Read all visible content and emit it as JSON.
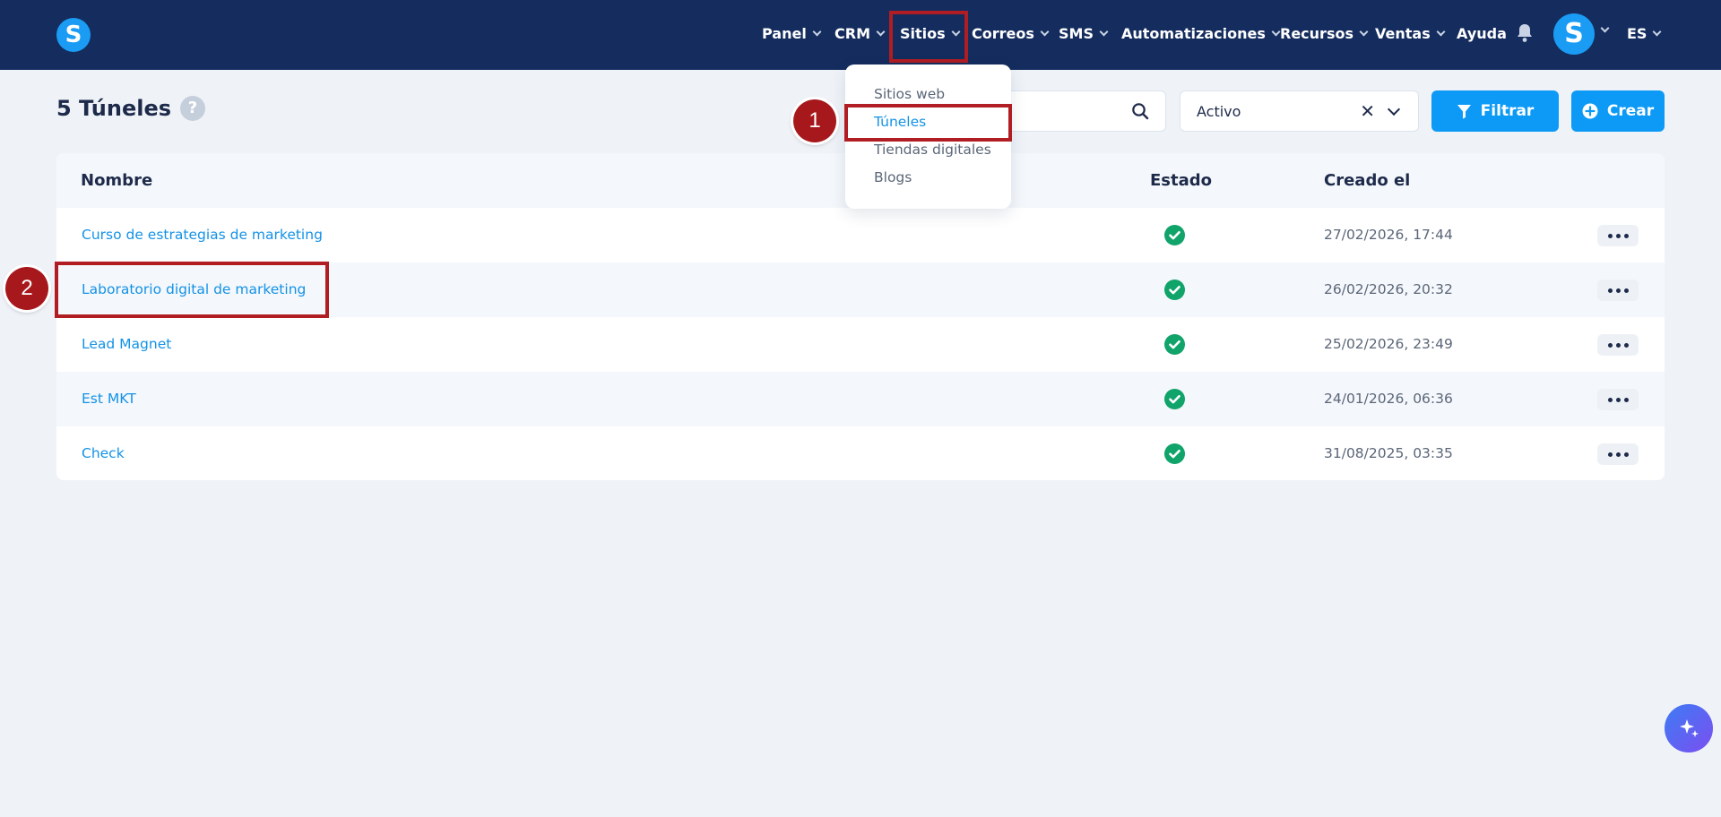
{
  "app": {
    "logo_letter": "S",
    "avatar_letter": "S"
  },
  "nav": {
    "items": [
      {
        "label": "Panel"
      },
      {
        "label": "CRM"
      },
      {
        "label": "Sitios"
      },
      {
        "label": "Correos"
      },
      {
        "label": "SMS"
      },
      {
        "label": "Automatizaciones"
      },
      {
        "label": "Recursos"
      },
      {
        "label": "Ventas"
      },
      {
        "label": "Ayuda"
      }
    ],
    "language": "ES",
    "bell_icon": "bell-icon"
  },
  "dropdown": {
    "items": [
      {
        "label": "Sitios web"
      },
      {
        "label": "Túneles",
        "active": true
      },
      {
        "label": "Tiendas digitales"
      },
      {
        "label": "Blogs"
      }
    ]
  },
  "page": {
    "title": "5 Túneles",
    "help": "?",
    "search_placeholder": "",
    "status_filter": "Activo",
    "filter_button": "Filtrar",
    "create_button": "Crear"
  },
  "table": {
    "headers": {
      "name": "Nombre",
      "status": "Estado",
      "created": "Creado el"
    },
    "rows": [
      {
        "name": "Curso de estrategias de marketing",
        "status": "active",
        "created": "27/02/2026, 17:44"
      },
      {
        "name": "Laboratorio digital de marketing",
        "status": "active",
        "created": "26/02/2026, 20:32"
      },
      {
        "name": "Lead Magnet",
        "status": "active",
        "created": "25/02/2026, 23:49"
      },
      {
        "name": "Est MKT",
        "status": "active",
        "created": "24/01/2026, 06:36"
      },
      {
        "name": "Check",
        "status": "active",
        "created": "31/08/2025, 03:35"
      }
    ]
  },
  "annotations": {
    "step1": "1",
    "step2": "2"
  },
  "colors": {
    "navbar": "#152d5e",
    "accent": "#0d9af6",
    "link": "#1492e6",
    "highlight": "#b01d22",
    "success": "#10a36a"
  }
}
